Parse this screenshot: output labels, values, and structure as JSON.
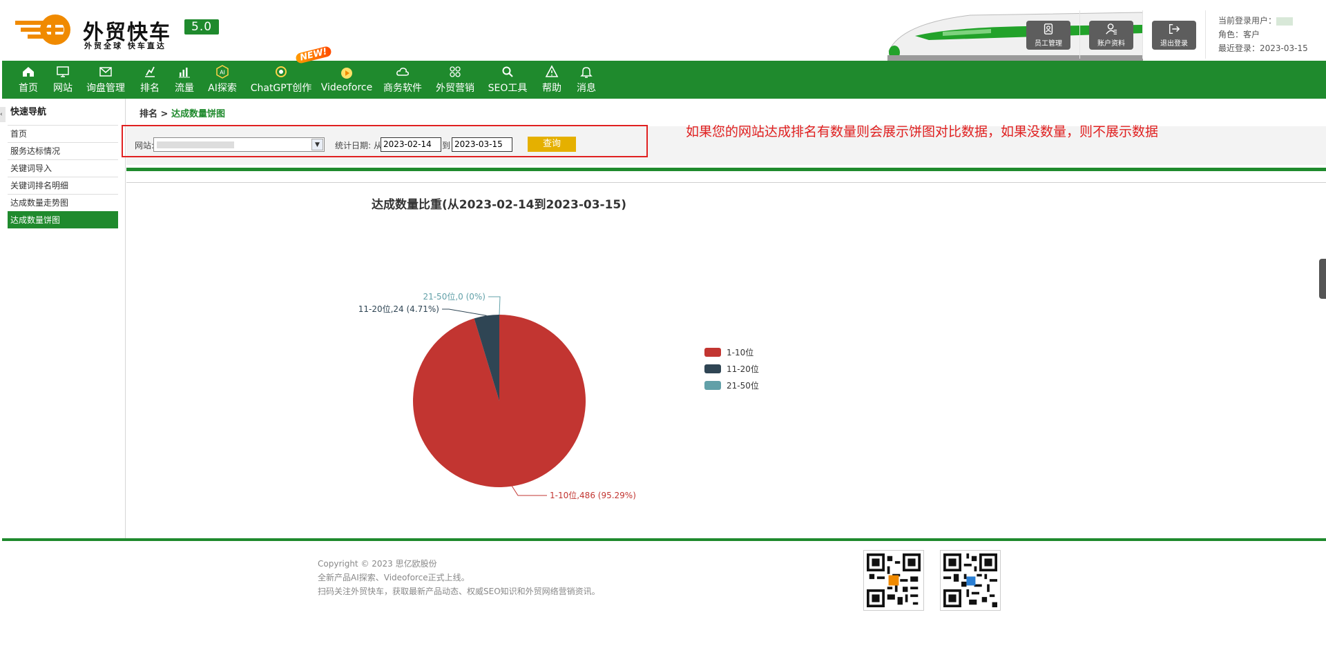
{
  "header": {
    "brand_name": "外贸快车",
    "slogan": "外贸全球 快车直达",
    "version": "5.0",
    "buttons": [
      {
        "label": "员工管理",
        "icon": "staff-icon"
      },
      {
        "label": "账户资料",
        "icon": "account-icon"
      },
      {
        "label": "退出登录",
        "icon": "logout-icon"
      }
    ],
    "user": {
      "current_user_label": "当前登录用户：",
      "role_label": "角色：",
      "role": "客户",
      "last_login_label": "最近登录：",
      "last_login": "2023-03-15"
    }
  },
  "nav": {
    "items": [
      {
        "label": "首页",
        "icon": "home-icon"
      },
      {
        "label": "网站",
        "icon": "monitor-icon"
      },
      {
        "label": "询盘管理",
        "icon": "mail-icon"
      },
      {
        "label": "排名",
        "icon": "ranking-icon"
      },
      {
        "label": "流量",
        "icon": "bar-chart-icon"
      },
      {
        "label": "AI探索",
        "icon": "ai-icon"
      },
      {
        "label": "ChatGPT创作",
        "icon": "chatgpt-icon"
      },
      {
        "label": "Videoforce",
        "icon": "video-icon"
      },
      {
        "label": "商务软件",
        "icon": "cloud-icon"
      },
      {
        "label": "外贸营销",
        "icon": "grid-icon"
      },
      {
        "label": "SEO工具",
        "icon": "search-icon"
      },
      {
        "label": "帮助",
        "icon": "warning-icon"
      },
      {
        "label": "消息",
        "icon": "bell-icon"
      }
    ],
    "new_badge": "NEW!"
  },
  "sidebar": {
    "title": "快速导航",
    "items": [
      {
        "label": "首页",
        "active": false
      },
      {
        "label": "服务达标情况",
        "active": false
      },
      {
        "label": "关键词导入",
        "active": false
      },
      {
        "label": "关键词排名明细",
        "active": false
      },
      {
        "label": "达成数量走势图",
        "active": false
      },
      {
        "label": "达成数量饼图",
        "active": true
      }
    ]
  },
  "breadcrumb": {
    "parent": "排名",
    "separator": " > ",
    "current": "达成数量饼图"
  },
  "filter": {
    "site_label": "网站:",
    "date_label": "统计日期: 从",
    "to_label": "到",
    "start_date": "2023-02-14",
    "end_date": "2023-03-15",
    "query_label": "查询"
  },
  "annotation": "如果您的网站达成排名有数量则会展示饼图对比数据，如果没数量，则不展示数据",
  "chart_data": {
    "type": "pie",
    "title": "达成数量比重(从2023-02-14到2023-03-15)",
    "categories": [
      "1-10位",
      "11-20位",
      "21-50位"
    ],
    "values": [
      486,
      24,
      0
    ],
    "percent_labels": [
      "95.29%",
      "4.71%",
      "0%"
    ],
    "slice_labels": [
      "1-10位,486 (95.29%)",
      "11-20位,24 (4.71%)",
      "21-50位,0 (0%)"
    ],
    "colors": [
      "#c23531",
      "#2f4554",
      "#61a0a8"
    ],
    "legend_position": "right"
  },
  "footer": {
    "lines": [
      "Copyright © 2023 思亿欧股份",
      "全新产品AI探索、Videoforce正式上线。",
      "扫码关注外贸快车，获取最新产品动态、权威SEO知识和外贸网络营销资讯。"
    ]
  },
  "colors": {
    "brand_green": "#1f8a2d",
    "accent_orange": "#f08a00",
    "query_yellow": "#e5b000",
    "alert_red": "#e02020"
  }
}
